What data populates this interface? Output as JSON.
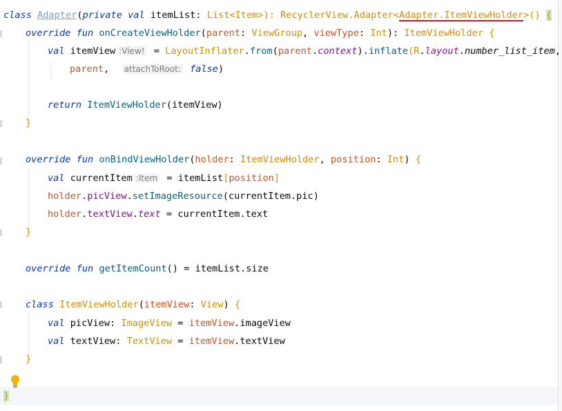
{
  "editor": {
    "lines": {
      "l1": {
        "kw_class": "class",
        "name": "Adapter",
        "p1": "(",
        "kw_private": "private",
        "kw_val": "val",
        "param": "itemList",
        "colon": ":",
        "list_type": "List",
        "lt": "<",
        "item": "Item",
        "gt_close": ">):",
        "super": "RecyclerView.Adapter",
        "lt2": "<",
        "generic": "Adapter.ItemViewHolder",
        "end": ">()",
        "brace": "{"
      },
      "l2": {
        "kw": "override fun",
        "fn": "onCreateViewHolder",
        "p1": "(",
        "parent": "parent",
        "c1": ":",
        "vg": "ViewGroup",
        "comma": ",",
        "vt": "viewType",
        "c2": ":",
        "int": "Int",
        "close": "):",
        "ret": "ItemViewHolder",
        "brace": "{"
      },
      "l3": {
        "kw": "val",
        "name": "itemView",
        "hint": ":View!",
        "eq": "=",
        "li": "LayoutInflater",
        "dot1": ".",
        "from": "from",
        "p1": "(",
        "parent": "parent",
        "dot2": ".",
        "context": "context",
        "close1": ").",
        "inflate": "inflate",
        "p2": "(",
        "r": "R",
        "dot3": ".",
        "layout": "layout",
        "dot4": ".",
        "res": "number_list_item",
        "comma": ","
      },
      "l4": {
        "parent": "parent",
        "comma": ",",
        "hint": "attachToRoot:",
        "false": "false",
        "close": ")"
      },
      "l6": {
        "kw": "return",
        "fn": "ItemViewHolder",
        "p1": "(",
        "arg": "itemView",
        "close": ")"
      },
      "l7": {
        "brace": "}"
      },
      "l9": {
        "kw": "override fun",
        "fn": "onBindViewHolder",
        "p1": "(",
        "holder": "holder",
        "c1": ":",
        "ivh": "ItemViewHolder",
        "comma": ",",
        "position": "position",
        "c2": ":",
        "int": "Int",
        "close": ")",
        "brace": "{"
      },
      "l10": {
        "kw": "val",
        "name": "currentItem",
        "hint": ":Item",
        "eq": "=",
        "list": "itemList",
        "lb": "[",
        "pos": "position",
        "rb": "]"
      },
      "l11": {
        "holder": "holder",
        "dot1": ".",
        "pic": "picView",
        "dot2": ".",
        "fn": "setImageResource",
        "p1": "(",
        "cur": "currentItem",
        "dot3": ".",
        "prop": "pic",
        "close": ")"
      },
      "l12": {
        "holder": "holder",
        "dot1": ".",
        "tv": "textView",
        "dot2": ".",
        "text": "text",
        "eq": "=",
        "cur": "currentItem",
        "dot3": ".",
        "prop": "text"
      },
      "l13": {
        "brace": "}"
      },
      "l15": {
        "kw": "override fun",
        "fn": "getItemCount",
        "parens": "()",
        "eq": "=",
        "list": "itemList",
        "dot": ".",
        "size": "size"
      },
      "l17": {
        "kw": "class",
        "name": "ItemViewHolder",
        "p1": "(",
        "param": "itemView",
        "c1": ":",
        "view": "View",
        "close": ")",
        "brace": "{"
      },
      "l18": {
        "kw": "val",
        "name": "picView",
        "c1": ":",
        "type": "ImageView",
        "eq": "=",
        "iv": "itemView",
        "dot": ".",
        "prop": "imageView"
      },
      "l19": {
        "kw": "val",
        "name": "textView",
        "c1": ":",
        "type": "TextView",
        "eq": "=",
        "iv": "itemView",
        "dot": ".",
        "prop": "textView"
      },
      "l20": {
        "brace": "}"
      },
      "l22": {
        "brace": "}"
      }
    }
  },
  "colors": {
    "keyword": "#0033b3",
    "function": "#00627a",
    "type": "#d18c00",
    "parameter": "#c7501a",
    "property": "#871094",
    "error_underline": "#e0141e"
  },
  "icons": {
    "intention": "lightbulb-icon"
  }
}
